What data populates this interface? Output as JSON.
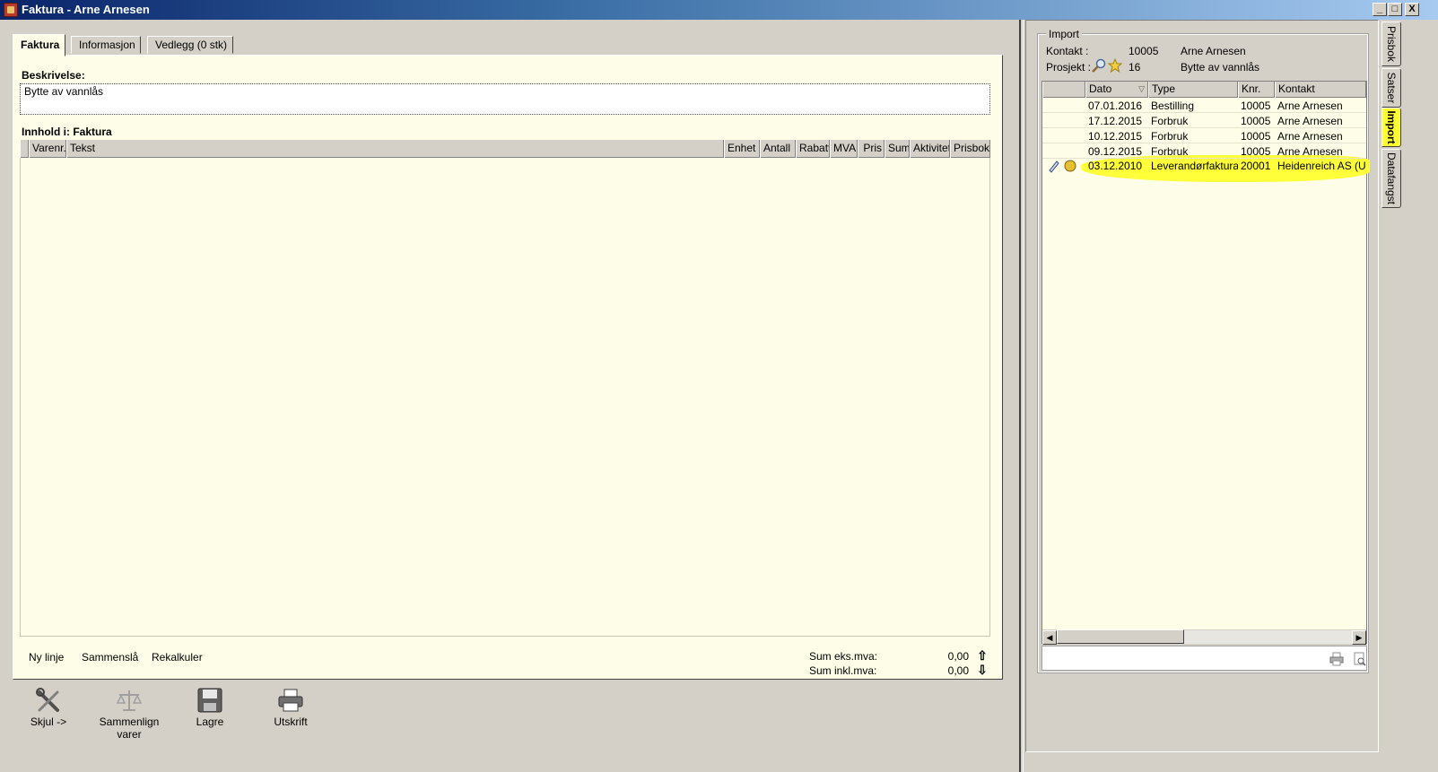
{
  "window": {
    "title": "Faktura - Arne Arnesen",
    "buttons": [
      "_",
      "□",
      "X"
    ]
  },
  "tabs": [
    "Faktura",
    "Informasjon",
    "Vedlegg (0 stk)"
  ],
  "description": {
    "label": "Beskrivelse:",
    "value": "Bytte av vannlås"
  },
  "content": {
    "label": "Innhold i: Faktura",
    "columns": [
      "Varenr.",
      "Tekst",
      "Enhet",
      "Antall",
      "Rabatt",
      "MVA",
      "Pris",
      "Sum",
      "Aktivitet",
      "Prisbok"
    ]
  },
  "footer": {
    "links": [
      "Ny linje",
      "Sammenslå",
      "Rekalkuler"
    ],
    "sum_eks_label": "Sum eks.mva:",
    "sum_eks_value": "0,00",
    "sum_inkl_label": "Sum inkl.mva:",
    "sum_inkl_value": "0,00"
  },
  "toolbar": {
    "skjul": "Skjul ->",
    "sammenlign_1": "Sammenlign",
    "sammenlign_2": "varer",
    "lagre": "Lagre",
    "utskrift": "Utskrift"
  },
  "import": {
    "legend": "Import",
    "kontakt_label": "Kontakt :",
    "kontakt_nr": "10005",
    "kontakt_name": "Arne Arnesen",
    "prosjekt_label": "Prosjekt :",
    "prosjekt_nr": "16",
    "prosjekt_name": "Bytte av vannlås",
    "columns": [
      "Dato",
      "Type",
      "Knr.",
      "Kontakt"
    ],
    "rows": [
      {
        "dato": "07.01.2016",
        "type": "Bestilling",
        "knr": "10005",
        "kontakt": "Arne Arnesen"
      },
      {
        "dato": "17.12.2015",
        "type": "Forbruk",
        "knr": "10005",
        "kontakt": "Arne Arnesen"
      },
      {
        "dato": "10.12.2015",
        "type": "Forbruk",
        "knr": "10005",
        "kontakt": "Arne Arnesen"
      },
      {
        "dato": "09.12.2015",
        "type": "Forbruk",
        "knr": "10005",
        "kontakt": "Arne Arnesen"
      },
      {
        "dato": "03.12.2010",
        "type": "Leverandørfaktura",
        "knr": "20001",
        "kontakt": "Heidenreich AS (Utg"
      }
    ]
  },
  "side_tabs": [
    "Prisbok",
    "Satser",
    "Import",
    "Datafangst"
  ],
  "colors": {
    "highlight": "#ffff30",
    "panel_bg": "#fefee8",
    "chrome": "#d4d0c8"
  }
}
